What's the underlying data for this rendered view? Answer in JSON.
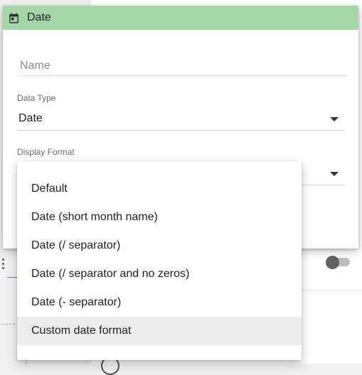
{
  "dialog": {
    "title": "Date",
    "icon": "calendar-icon",
    "header_color": "#a5d6a7",
    "name_field": {
      "placeholder": "Name",
      "value": ""
    },
    "data_type": {
      "label": "Data Type",
      "value": "Date"
    },
    "display_format": {
      "label": "Display Format",
      "value": ""
    }
  },
  "dropdown": {
    "items": [
      "Default",
      "Date (short month name)",
      "Date (/ separator)",
      "Date (/ separator and no zeros)",
      "Date (- separator)",
      "Custom date format"
    ],
    "highlighted_index": 5
  }
}
